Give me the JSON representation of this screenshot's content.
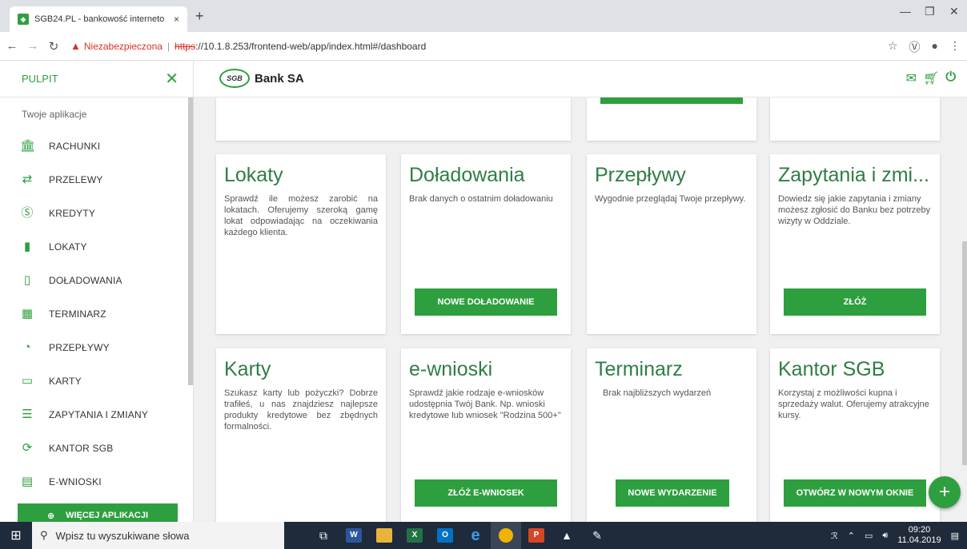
{
  "browser": {
    "tab_title": "SGB24.PL - bankowość interneto",
    "tab_close": "×",
    "new_tab": "+",
    "security_label": "Niezabezpieczona",
    "url_scheme": "https",
    "url_rest": "://10.1.8.253/frontend-web/app/index.html#/dashboard"
  },
  "sidebar": {
    "title": "PULPIT",
    "apps_label": "Twoje aplikacje",
    "items": [
      {
        "label": "RACHUNKI",
        "icon": "bank-icon"
      },
      {
        "label": "PRZELEWY",
        "icon": "transfer-icon"
      },
      {
        "label": "KREDYTY",
        "icon": "dollar-icon"
      },
      {
        "label": "LOKATY",
        "icon": "coins-icon"
      },
      {
        "label": "DOŁADOWANIA",
        "icon": "phone-icon"
      },
      {
        "label": "TERMINARZ",
        "icon": "calendar-icon"
      },
      {
        "label": "PRZEPŁYWY",
        "icon": "clock-icon"
      },
      {
        "label": "KARTY",
        "icon": "card-icon"
      },
      {
        "label": "ZAPYTANIA I ZMIANY",
        "icon": "document-icon"
      },
      {
        "label": "KANTOR SGB",
        "icon": "exchange-icon"
      },
      {
        "label": "E-WNIOSKI",
        "icon": "form-icon"
      }
    ],
    "more_apps": "WIĘCEJ APLIKACJI"
  },
  "header": {
    "logo_text": "SGB",
    "bank_name": "Bank SA"
  },
  "cards": {
    "lokaty": {
      "title": "Lokaty",
      "text": "Sprawdź ile możesz zarobić na lokatach. Oferujemy szeroką gamę lokat odpowiadając na oczekiwania każdego klienta."
    },
    "doladowania": {
      "title": "Doładowania",
      "text": "Brak danych o ostatnim doładowaniu",
      "button": "NOWE DOŁADOWANIE"
    },
    "przeplywy": {
      "title": "Przepływy",
      "text": "Wygodnie przeglądaj Twoje przepływy."
    },
    "zapytania": {
      "title": "Zapytania i zmi...",
      "text": "Dowiedz się jakie zapytania i zmiany możesz zgłosić do Banku bez potrzeby wizyty w Oddziale.",
      "button": "ZŁÓŻ"
    },
    "karty": {
      "title": "Karty",
      "text": "Szukasz karty lub pożyczki? Dobrze trafiłeś, u nas znajdziesz najlepsze produkty kredytowe bez zbędnych formalności."
    },
    "ewnioski": {
      "title": "e-wnioski",
      "text": "Sprawdź jakie rodzaje e-wniosków udostępnia Twój Bank. Np. wnioski kredytowe lub wniosek \"Rodzina 500+\"",
      "button": "ZŁÓŻ E-WNIOSEK"
    },
    "terminarz": {
      "title": "Terminarz",
      "text": "Brak najbliższych wydarzeń",
      "button": "NOWE WYDARZENIE"
    },
    "kantor": {
      "title": "Kantor SGB",
      "text": "Korzystaj z możliwości kupna i sprzedaży walut. Oferujemy atrakcyjne kursy.",
      "button": "OTWÓRZ W NOWYM OKNIE"
    }
  },
  "taskbar": {
    "search_placeholder": "Wpisz tu wyszukiwane słowa",
    "time": "09:20",
    "date": "11.04.2019"
  },
  "colors": {
    "accent": "#2e9f3e",
    "title_green": "#2f7d45"
  }
}
